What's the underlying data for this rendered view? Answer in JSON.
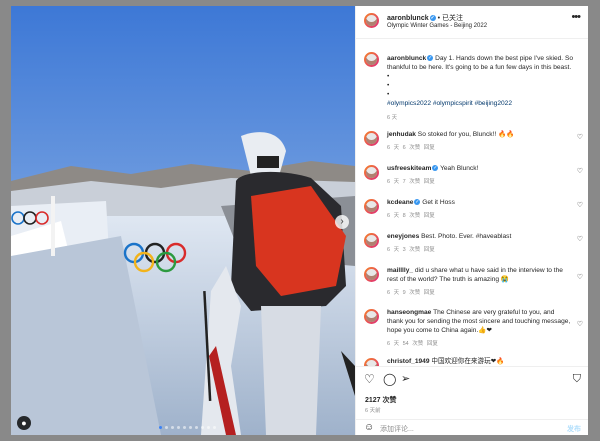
{
  "post": {
    "username": "aaronblunck",
    "follow_label": "• 已关注",
    "location": "Olympic Winter Games - Beijing 2022",
    "caption_text": "Day 1. Hands down the best pipe I've skied. So thankful to be here. It's going to be a fun few days in this beast.",
    "caption_bullets": [
      "•",
      "•",
      "•"
    ],
    "hashtags": "#olympics2022 #olympicspirit #beijing2022",
    "caption_time": "6 天"
  },
  "comments": [
    {
      "user": "jenhudak",
      "text": "So stoked for you, Blunck!! 🔥🔥",
      "time": "6 天",
      "likes": "6 次赞",
      "reply": "回复"
    },
    {
      "user": "usfreeskiteam",
      "text": "Yeah Blunck!",
      "time": "6 天",
      "likes": "7 次赞",
      "reply": "回复"
    },
    {
      "user": "kcdeane",
      "text": "Get it Hoss",
      "time": "6 天",
      "likes": "8 次赞",
      "reply": "回复"
    },
    {
      "user": "eneyjones",
      "text": "Best. Photo. Ever. #haveablast",
      "time": "6 天",
      "likes": "3 次赞",
      "reply": "回复"
    },
    {
      "user": "mailllly_",
      "text": "did u share what u have said in the interview to the rest of the world? The truth is amazing 😭",
      "time": "6 天",
      "likes": "9 次赞",
      "reply": "回复"
    },
    {
      "user": "hanseongmae",
      "text": "The Chinese are very grateful to you, and thank you for sending the most sincere and touching message, hope you come to China again.👍❤",
      "time": "6 天",
      "likes": "54 次赞",
      "reply": "回复"
    },
    {
      "user": "christof_1949",
      "text": "中国欢迎你在来游玩❤🔥",
      "time": "",
      "likes": "",
      "reply": ""
    }
  ],
  "actions": {
    "likes_count": "2127 次赞",
    "time_ago": "6 天前",
    "comment_placeholder": "添加评论...",
    "post_label": "发布"
  },
  "icons": {
    "more": "more-icon",
    "next": "chevron-right-icon",
    "tag": "user-tag-icon",
    "heart": "heart-icon",
    "comment": "comment-icon",
    "share": "share-icon",
    "save": "bookmark-icon",
    "emoji": "emoji-icon"
  },
  "carousel": {
    "slides": 10,
    "active_index": 0
  },
  "colors": {
    "link": "#00376b",
    "verified": "#3897f0",
    "meta": "#8e8e8e",
    "post_button": "#b2dffc"
  }
}
